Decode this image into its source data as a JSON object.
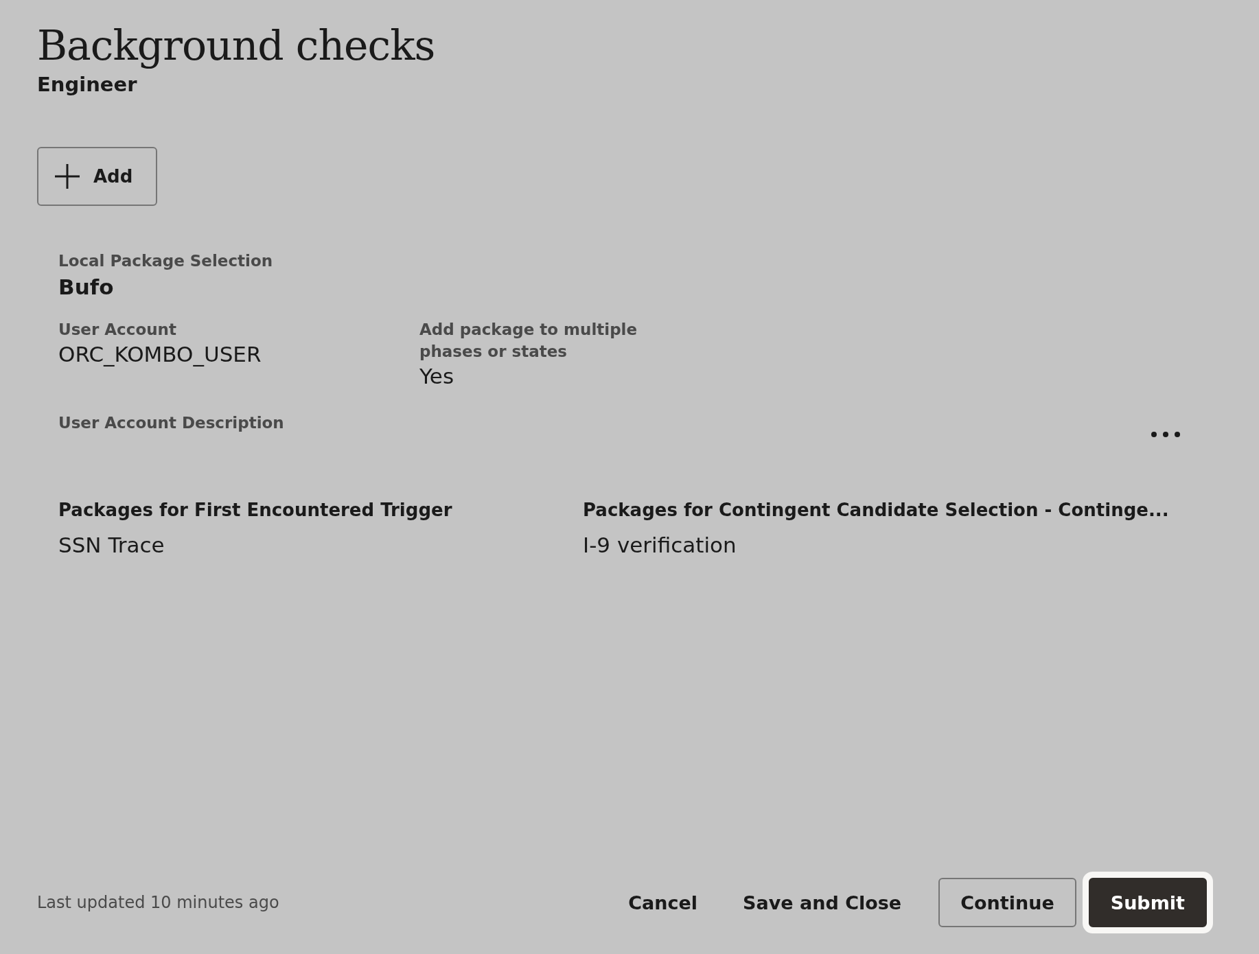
{
  "header": {
    "title": "Background checks",
    "subtitle": "Engineer"
  },
  "add_button": {
    "label": "Add"
  },
  "package": {
    "label": "Local Package Selection",
    "value": "Bufo",
    "fields": [
      {
        "label": "User Account",
        "value": "ORC_KOMBO_USER"
      },
      {
        "label": "Add package to multiple phases or states",
        "value": "Yes"
      }
    ],
    "description_label": "User Account Description",
    "groups": [
      {
        "label": "Packages for First Encountered Trigger",
        "value": "SSN Trace"
      },
      {
        "label": "Packages for Contingent Candidate Selection - Continge...",
        "value": "I-9 verification"
      }
    ]
  },
  "footer": {
    "status": "Last updated 10 minutes ago",
    "buttons": [
      {
        "label": "Cancel",
        "kind": "text",
        "focused": false
      },
      {
        "label": "Save and Close",
        "kind": "text",
        "focused": false
      },
      {
        "label": "Continue",
        "kind": "outlined",
        "focused": false
      },
      {
        "label": "Submit",
        "kind": "primary",
        "focused": true
      }
    ]
  }
}
